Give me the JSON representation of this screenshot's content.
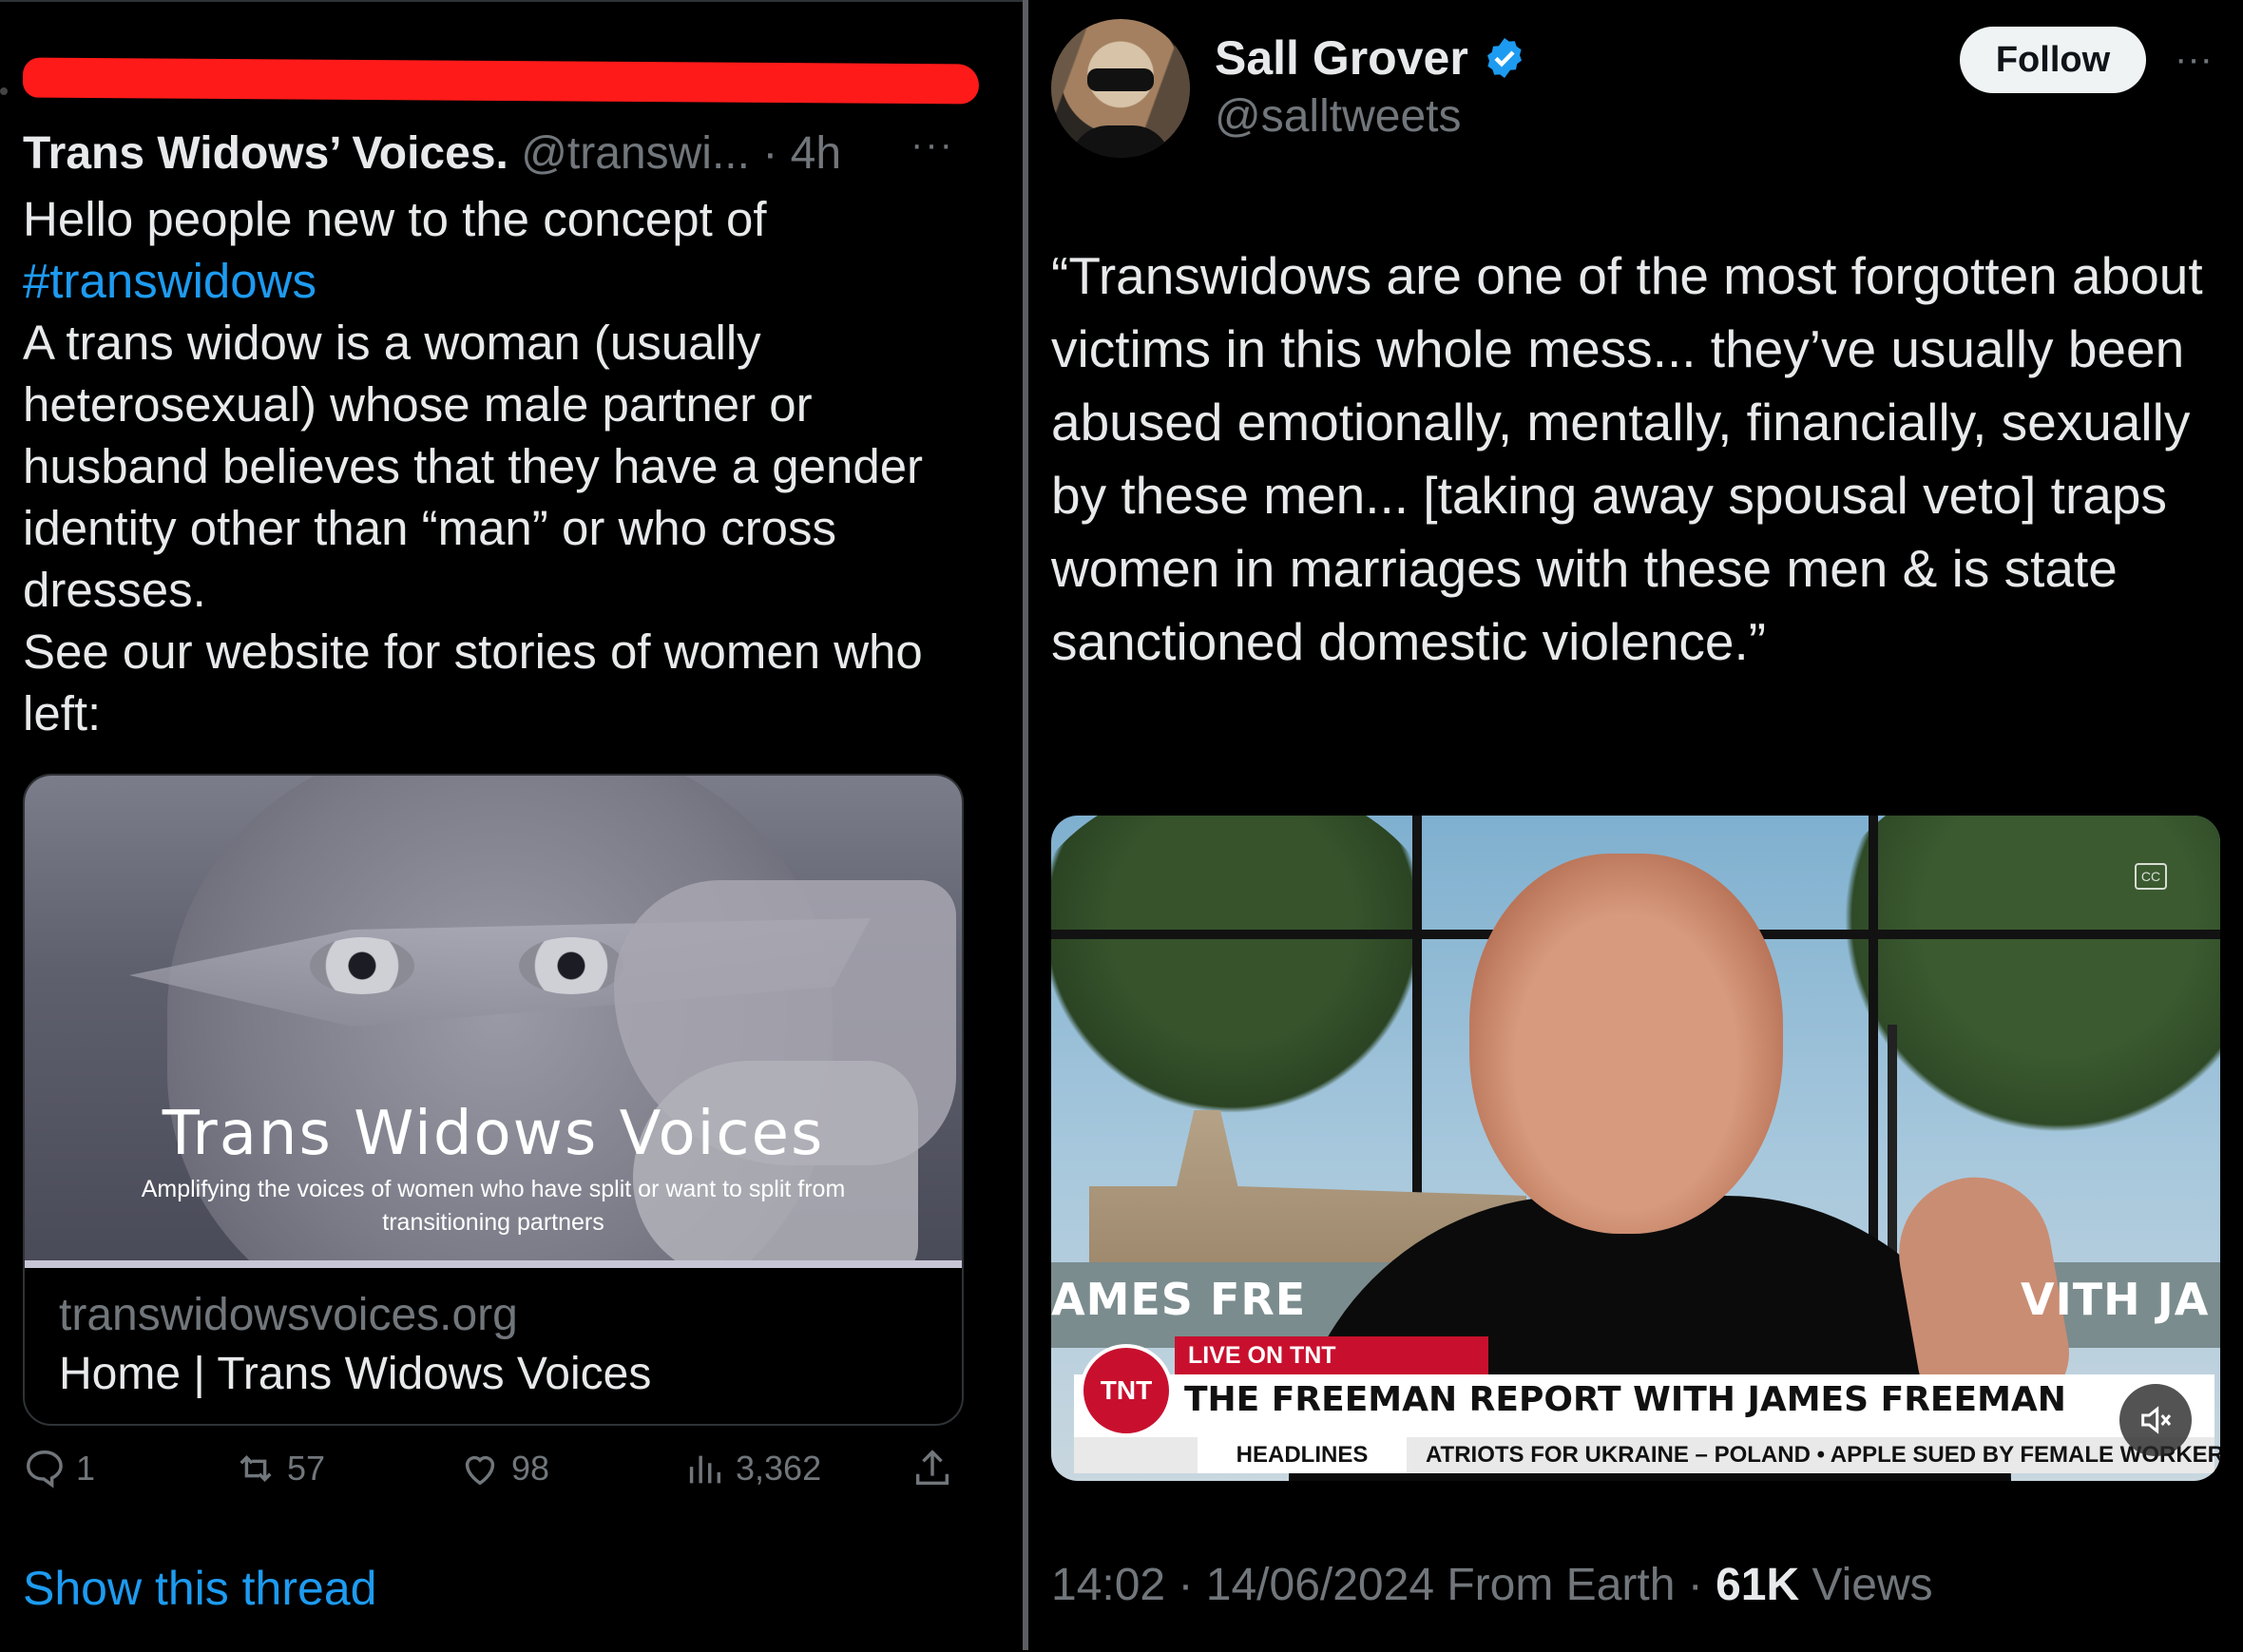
{
  "left_tweet": {
    "author": "Trans Widows’ Voices.",
    "handle": "@transwi...",
    "separator": "·",
    "time": "4h",
    "more": "···",
    "line1": "Hello people new to the concept of",
    "hashtag": "#transwidows",
    "line2": "A trans widow is a woman (usually heterosexual) whose male partner or husband believes that they have a gender identity other than “man” or who cross dresses.",
    "line3": "See our website for stories of women who left:",
    "card": {
      "image_title": "Trans Widows Voices",
      "image_subtitle": "Amplifying the voices of women who have split or want to split from transitioning partners",
      "domain": "transwidowsvoices.org",
      "page_title": "Home | Trans Widows Voices"
    },
    "actions": {
      "replies": "1",
      "reposts": "57",
      "likes": "98",
      "views": "3,362"
    },
    "show_thread": "Show this thread"
  },
  "right_tweet": {
    "author": "Sall Grover",
    "handle": "@salltweets",
    "follow_label": "Follow",
    "more": "···",
    "quote": "“Transwidows are one of the most forgotten about victims in this whole mess... they’ve usually been abused emotionally, mentally, financially, sexually by these men... [taking away spousal veto] traps women in marriages with these men & is state sanctioned domestic violence.”",
    "video": {
      "marquee_left": "AMES FRE",
      "marquee_right": "VITH JA",
      "live_tag": "LIVE ON TNT",
      "logo": "TNT",
      "show_title": "THE FREEMAN REPORT WITH JAMES FREEMAN",
      "ticker_label": "HEADLINES",
      "ticker_text": "ATRIOTS FOR UKRAINE – POLAND  •  APPLE SUED BY FEMALE WORKERS  •  BI",
      "cc": "CC"
    },
    "meta": {
      "time": "14:02",
      "dot1": " · ",
      "date": "14/06/2024",
      "source": " From Earth",
      "dot2": " · ",
      "views_count": "61K",
      "views_label": " Views"
    }
  },
  "colors": {
    "accent": "#1d9bf0",
    "redaction": "#ff1a1a",
    "muted": "#71767b",
    "text": "#e7e9ea"
  }
}
